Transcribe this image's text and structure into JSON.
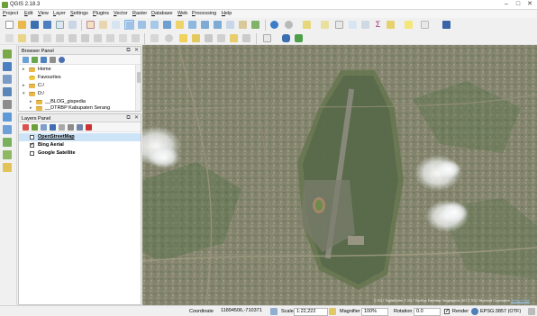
{
  "window": {
    "title": "QGIS 2.18.3"
  },
  "menu": [
    "Project",
    "Edit",
    "View",
    "Layer",
    "Settings",
    "Plugins",
    "Vector",
    "Raster",
    "Database",
    "Web",
    "Processing",
    "Help"
  ],
  "browser_panel": {
    "title": "Browser Panel",
    "items": [
      {
        "label": "Home",
        "icon": "home-folder-icon"
      },
      {
        "label": "Favourites",
        "icon": "star-icon"
      },
      {
        "label": "C:/",
        "icon": "drive-icon"
      },
      {
        "label": "D:/",
        "icon": "drive-icon"
      },
      {
        "label": "__BLOG_gispedia",
        "icon": "folder-icon"
      },
      {
        "label": "__DTRBP Kabupaten Serang",
        "icon": "folder-icon"
      }
    ]
  },
  "layers_panel": {
    "title": "Layers Panel",
    "layers": [
      {
        "label": "OpenStreetMap",
        "checked": false,
        "selected": true
      },
      {
        "label": "Bing Aerial",
        "checked": true,
        "selected": false
      },
      {
        "label": "Google Satellite",
        "checked": false,
        "selected": false
      }
    ]
  },
  "map": {
    "attribution": "© 2017 DigitalGlobe © 2017 GeoEye Earthstar Geographics SIO © 2017 Microsoft Corporation",
    "attribution_link": "Terms of Use"
  },
  "status": {
    "coordinate_label": "Coordinate",
    "coordinate_value": "11894506,-710371",
    "scale_label": "Scale",
    "scale_value": "1:22,222",
    "magnifier_label": "Magnifier",
    "magnifier_value": "100%",
    "rotation_label": "Rotation",
    "rotation_value": "0.0",
    "render_label": "Render",
    "render_checked": true,
    "crs": "EPSG:3857 (OTF)"
  },
  "colors": {
    "selection": "#cde3f7",
    "folder": "#e8b84a",
    "accent_green": "#6a9f3a"
  }
}
